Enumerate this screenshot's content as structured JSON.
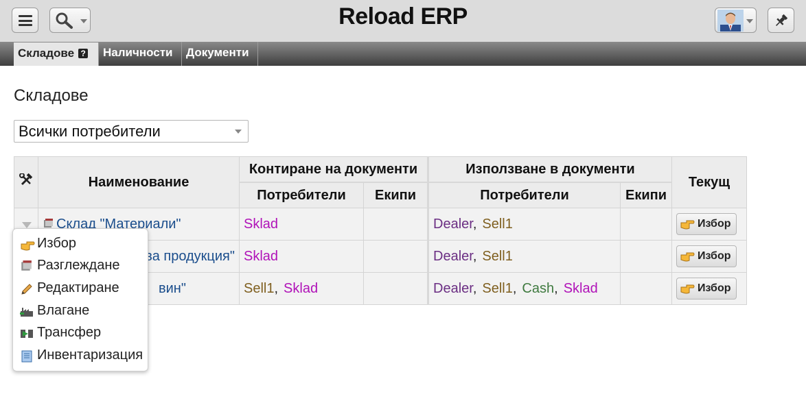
{
  "app": {
    "title": "Reload ERP"
  },
  "tabs": [
    {
      "label": "Складове",
      "help": "?"
    },
    {
      "label": "Наличности"
    },
    {
      "label": "Документи"
    }
  ],
  "page": {
    "heading": "Складове"
  },
  "filter": {
    "selected": "Всички потребители"
  },
  "table": {
    "headers": {
      "name": "Наименование",
      "posting_group": "Контиране на документи",
      "usage_group": "Използване в документи",
      "users": "Потребители",
      "teams": "Екипи",
      "current": "Текущ"
    },
    "rows": [
      {
        "name": "Склад \"Материали\"",
        "post_users": [
          "Sklad"
        ],
        "use_users": [
          "Dealer",
          "Sell1"
        ],
        "button": "Избор"
      },
      {
        "name": "ва продукция\"",
        "post_users": [
          "Sklad"
        ],
        "use_users": [
          "Dealer",
          "Sell1"
        ],
        "button": "Избор"
      },
      {
        "name": "вин\"",
        "post_users": [
          "Sell1",
          "Sklad"
        ],
        "use_users": [
          "Dealer",
          "Sell1",
          "Cash",
          "Sklad"
        ],
        "button": "Избор"
      }
    ]
  },
  "context_menu": {
    "items": [
      {
        "label": "Избор",
        "icon": "pointing-hand-icon"
      },
      {
        "label": "Разглеждане",
        "icon": "box-icon"
      },
      {
        "label": "Редактиране",
        "icon": "pencil-icon"
      },
      {
        "label": "Влагане",
        "icon": "factory-icon"
      },
      {
        "label": "Трансфер",
        "icon": "transfer-icon"
      },
      {
        "label": "Инвентаризация",
        "icon": "scroll-icon"
      }
    ]
  },
  "colors": {
    "link": "#1a4d8c",
    "Sklad": "#b012b8",
    "Dealer": "#6b2e83",
    "Sell1": "#7f5f1f",
    "Cash": "#3f7a3f"
  }
}
